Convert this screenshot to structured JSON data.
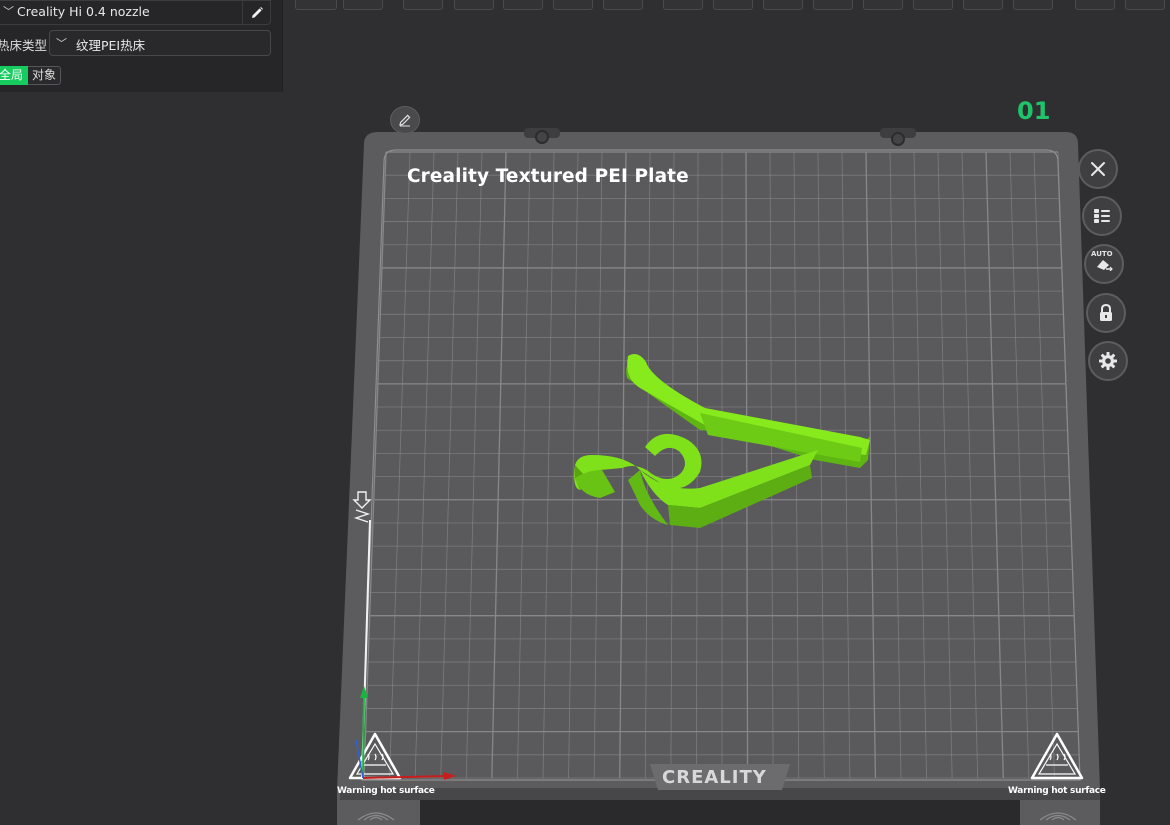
{
  "left_panel": {
    "printer_name": "Creality Hi 0.4 nozzle",
    "bed_type_label": "热床类型",
    "bed_type_value": "纹理PEI热床",
    "scope_tabs": [
      "全局",
      "对象"
    ],
    "active_scope": "全局"
  },
  "plate": {
    "title": "Creality Textured PEI Plate",
    "number": "01",
    "brand": "CREALITY",
    "warning_left": "Warning hot surface",
    "warning_right": "Warning hot surface",
    "side_buttons": [
      "close-icon",
      "arrange-icon",
      "auto-orient-icon",
      "lock-icon",
      "settings-icon"
    ],
    "auto_label": "AUTO"
  },
  "colors": {
    "accent_green": "#17cc5f",
    "plate_number": "#1fc46a",
    "model": "#7ee11a",
    "plate": "#5b5b5d",
    "grid_line": "#8a8a8c"
  }
}
